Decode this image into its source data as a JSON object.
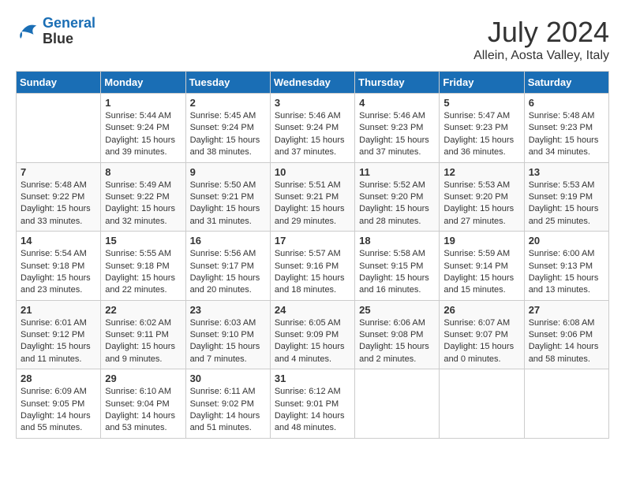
{
  "header": {
    "logo_line1": "General",
    "logo_line2": "Blue",
    "month_year": "July 2024",
    "location": "Allein, Aosta Valley, Italy"
  },
  "weekdays": [
    "Sunday",
    "Monday",
    "Tuesday",
    "Wednesday",
    "Thursday",
    "Friday",
    "Saturday"
  ],
  "weeks": [
    [
      {
        "day": "",
        "sunrise": "",
        "sunset": "",
        "daylight": ""
      },
      {
        "day": "1",
        "sunrise": "Sunrise: 5:44 AM",
        "sunset": "Sunset: 9:24 PM",
        "daylight": "Daylight: 15 hours and 39 minutes."
      },
      {
        "day": "2",
        "sunrise": "Sunrise: 5:45 AM",
        "sunset": "Sunset: 9:24 PM",
        "daylight": "Daylight: 15 hours and 38 minutes."
      },
      {
        "day": "3",
        "sunrise": "Sunrise: 5:46 AM",
        "sunset": "Sunset: 9:24 PM",
        "daylight": "Daylight: 15 hours and 37 minutes."
      },
      {
        "day": "4",
        "sunrise": "Sunrise: 5:46 AM",
        "sunset": "Sunset: 9:23 PM",
        "daylight": "Daylight: 15 hours and 37 minutes."
      },
      {
        "day": "5",
        "sunrise": "Sunrise: 5:47 AM",
        "sunset": "Sunset: 9:23 PM",
        "daylight": "Daylight: 15 hours and 36 minutes."
      },
      {
        "day": "6",
        "sunrise": "Sunrise: 5:48 AM",
        "sunset": "Sunset: 9:23 PM",
        "daylight": "Daylight: 15 hours and 34 minutes."
      }
    ],
    [
      {
        "day": "7",
        "sunrise": "Sunrise: 5:48 AM",
        "sunset": "Sunset: 9:22 PM",
        "daylight": "Daylight: 15 hours and 33 minutes."
      },
      {
        "day": "8",
        "sunrise": "Sunrise: 5:49 AM",
        "sunset": "Sunset: 9:22 PM",
        "daylight": "Daylight: 15 hours and 32 minutes."
      },
      {
        "day": "9",
        "sunrise": "Sunrise: 5:50 AM",
        "sunset": "Sunset: 9:21 PM",
        "daylight": "Daylight: 15 hours and 31 minutes."
      },
      {
        "day": "10",
        "sunrise": "Sunrise: 5:51 AM",
        "sunset": "Sunset: 9:21 PM",
        "daylight": "Daylight: 15 hours and 29 minutes."
      },
      {
        "day": "11",
        "sunrise": "Sunrise: 5:52 AM",
        "sunset": "Sunset: 9:20 PM",
        "daylight": "Daylight: 15 hours and 28 minutes."
      },
      {
        "day": "12",
        "sunrise": "Sunrise: 5:53 AM",
        "sunset": "Sunset: 9:20 PM",
        "daylight": "Daylight: 15 hours and 27 minutes."
      },
      {
        "day": "13",
        "sunrise": "Sunrise: 5:53 AM",
        "sunset": "Sunset: 9:19 PM",
        "daylight": "Daylight: 15 hours and 25 minutes."
      }
    ],
    [
      {
        "day": "14",
        "sunrise": "Sunrise: 5:54 AM",
        "sunset": "Sunset: 9:18 PM",
        "daylight": "Daylight: 15 hours and 23 minutes."
      },
      {
        "day": "15",
        "sunrise": "Sunrise: 5:55 AM",
        "sunset": "Sunset: 9:18 PM",
        "daylight": "Daylight: 15 hours and 22 minutes."
      },
      {
        "day": "16",
        "sunrise": "Sunrise: 5:56 AM",
        "sunset": "Sunset: 9:17 PM",
        "daylight": "Daylight: 15 hours and 20 minutes."
      },
      {
        "day": "17",
        "sunrise": "Sunrise: 5:57 AM",
        "sunset": "Sunset: 9:16 PM",
        "daylight": "Daylight: 15 hours and 18 minutes."
      },
      {
        "day": "18",
        "sunrise": "Sunrise: 5:58 AM",
        "sunset": "Sunset: 9:15 PM",
        "daylight": "Daylight: 15 hours and 16 minutes."
      },
      {
        "day": "19",
        "sunrise": "Sunrise: 5:59 AM",
        "sunset": "Sunset: 9:14 PM",
        "daylight": "Daylight: 15 hours and 15 minutes."
      },
      {
        "day": "20",
        "sunrise": "Sunrise: 6:00 AM",
        "sunset": "Sunset: 9:13 PM",
        "daylight": "Daylight: 15 hours and 13 minutes."
      }
    ],
    [
      {
        "day": "21",
        "sunrise": "Sunrise: 6:01 AM",
        "sunset": "Sunset: 9:12 PM",
        "daylight": "Daylight: 15 hours and 11 minutes."
      },
      {
        "day": "22",
        "sunrise": "Sunrise: 6:02 AM",
        "sunset": "Sunset: 9:11 PM",
        "daylight": "Daylight: 15 hours and 9 minutes."
      },
      {
        "day": "23",
        "sunrise": "Sunrise: 6:03 AM",
        "sunset": "Sunset: 9:10 PM",
        "daylight": "Daylight: 15 hours and 7 minutes."
      },
      {
        "day": "24",
        "sunrise": "Sunrise: 6:05 AM",
        "sunset": "Sunset: 9:09 PM",
        "daylight": "Daylight: 15 hours and 4 minutes."
      },
      {
        "day": "25",
        "sunrise": "Sunrise: 6:06 AM",
        "sunset": "Sunset: 9:08 PM",
        "daylight": "Daylight: 15 hours and 2 minutes."
      },
      {
        "day": "26",
        "sunrise": "Sunrise: 6:07 AM",
        "sunset": "Sunset: 9:07 PM",
        "daylight": "Daylight: 15 hours and 0 minutes."
      },
      {
        "day": "27",
        "sunrise": "Sunrise: 6:08 AM",
        "sunset": "Sunset: 9:06 PM",
        "daylight": "Daylight: 14 hours and 58 minutes."
      }
    ],
    [
      {
        "day": "28",
        "sunrise": "Sunrise: 6:09 AM",
        "sunset": "Sunset: 9:05 PM",
        "daylight": "Daylight: 14 hours and 55 minutes."
      },
      {
        "day": "29",
        "sunrise": "Sunrise: 6:10 AM",
        "sunset": "Sunset: 9:04 PM",
        "daylight": "Daylight: 14 hours and 53 minutes."
      },
      {
        "day": "30",
        "sunrise": "Sunrise: 6:11 AM",
        "sunset": "Sunset: 9:02 PM",
        "daylight": "Daylight: 14 hours and 51 minutes."
      },
      {
        "day": "31",
        "sunrise": "Sunrise: 6:12 AM",
        "sunset": "Sunset: 9:01 PM",
        "daylight": "Daylight: 14 hours and 48 minutes."
      },
      {
        "day": "",
        "sunrise": "",
        "sunset": "",
        "daylight": ""
      },
      {
        "day": "",
        "sunrise": "",
        "sunset": "",
        "daylight": ""
      },
      {
        "day": "",
        "sunrise": "",
        "sunset": "",
        "daylight": ""
      }
    ]
  ]
}
